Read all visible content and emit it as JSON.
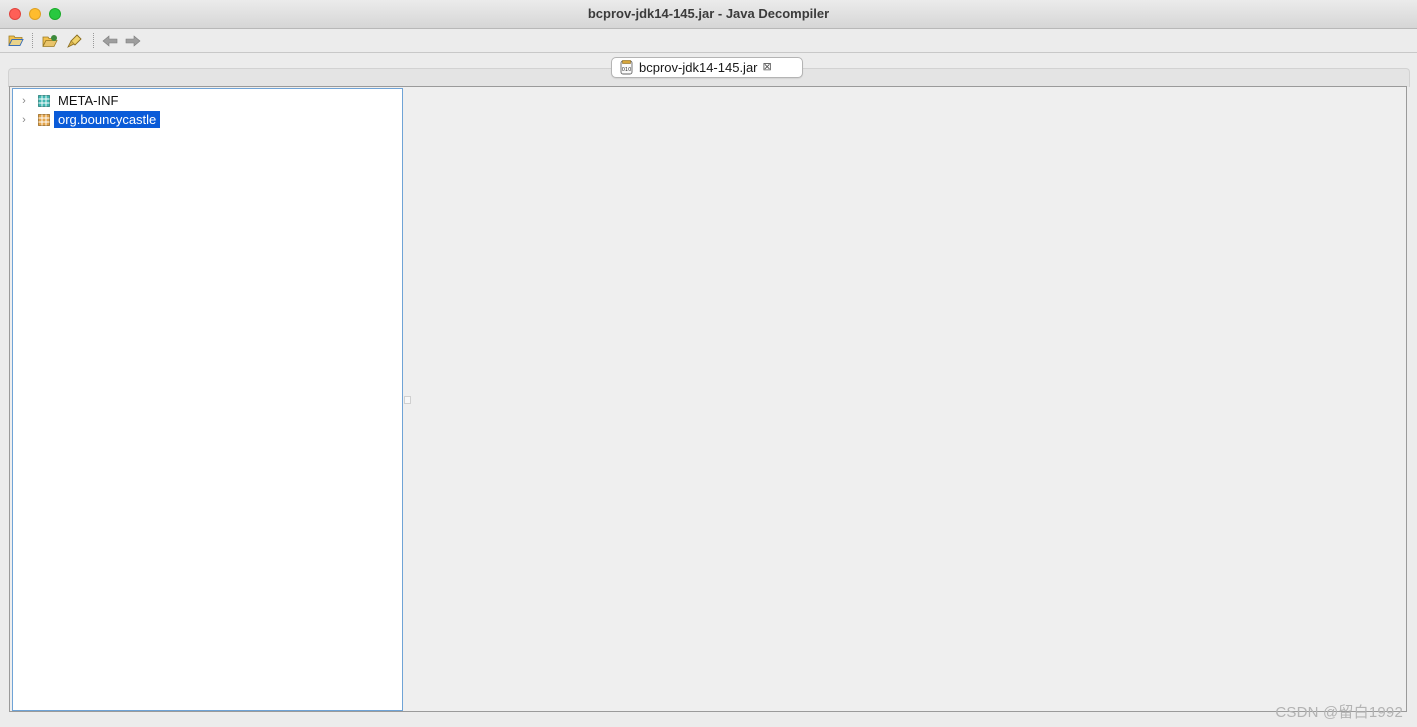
{
  "window": {
    "title": "bcprov-jdk14-145.jar - Java Decompiler"
  },
  "toolbar": {
    "buttons": [
      {
        "name": "open-file",
        "icon": "folder-open-icon"
      },
      {
        "name": "open-type",
        "icon": "folder-search-icon"
      },
      {
        "name": "search",
        "icon": "flashlight-icon"
      },
      {
        "name": "back",
        "icon": "arrow-left-icon"
      },
      {
        "name": "forward",
        "icon": "arrow-right-icon"
      }
    ]
  },
  "tabs": [
    {
      "label": "bcprov-jdk14-145.jar",
      "icon": "jar-file-icon",
      "close": "⊠"
    }
  ],
  "tree": {
    "items": [
      {
        "label": "META-INF",
        "expander": "›",
        "icon": "package-icon",
        "selected": false
      },
      {
        "label": "org.bouncycastle",
        "expander": "›",
        "icon": "package-icon",
        "selected": true
      }
    ]
  },
  "colors": {
    "selection": "#0a5bd8",
    "tree_border": "#6fa3d6"
  },
  "watermark": "CSDN @留白1992"
}
